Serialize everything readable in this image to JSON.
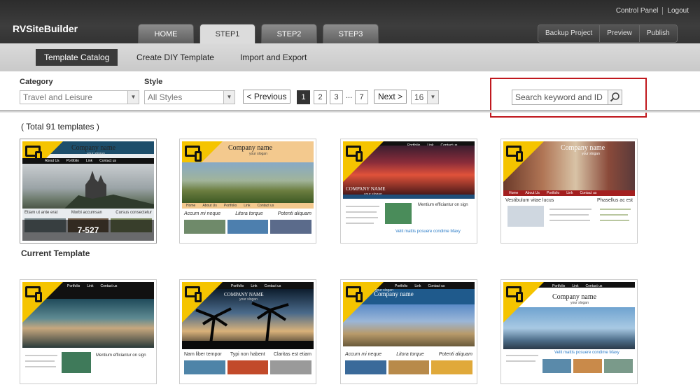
{
  "header": {
    "brand": "RVSiteBuilder",
    "top_links": [
      "Control Panel",
      "Logout"
    ],
    "steps": [
      "HOME",
      "STEP1",
      "STEP2",
      "STEP3"
    ],
    "active_step": "STEP1",
    "actions": [
      "Backup Project",
      "Preview",
      "Publish"
    ]
  },
  "subnav": {
    "tabs": [
      "Template Catalog",
      "Create DIY Template",
      "Import and Export"
    ],
    "active_tab": "Template Catalog"
  },
  "filters": {
    "category_label": "Category",
    "category_value": "Travel and Leisure",
    "style_label": "Style",
    "style_value": "All Styles",
    "previous_label": "< Previous",
    "next_label": "Next >",
    "pages": [
      "1",
      "2",
      "3",
      "7"
    ],
    "current_page": "1",
    "ellipsis": "...",
    "per_page": "16",
    "search_placeholder": "Search keyword and ID"
  },
  "catalog": {
    "total_text": "( Total 91 templates )",
    "current_template_label": "Current Template",
    "current_template_id": "7-527",
    "templates": [
      {
        "company": "Company name",
        "slogan": "your slogan",
        "captions": [
          "Etiam ut ante erat",
          "Morbi accumsan",
          "Cursus consectetur"
        ],
        "nav": [
          "About Us",
          "Portfolio",
          "Link",
          "Contact us"
        ]
      },
      {
        "company": "Company name",
        "slogan": "your slogan",
        "captions": [
          "Accum mi neque",
          "Litora torque",
          "Potenti aliquam"
        ],
        "nav": [
          "Home",
          "About Us",
          "Portfolio",
          "Link",
          "Contact us"
        ]
      },
      {
        "company": "COMPANY NAME",
        "slogan": "your slogan",
        "captions": [
          "Mentium efficiantur on sign",
          "Velit mattis posuere condime Maxy"
        ],
        "nav": [
          "Portfolio",
          "Link",
          "Contact us"
        ]
      },
      {
        "company": "Company name",
        "slogan": "your slogan",
        "captions": [
          "Vestibulum vitae lucus",
          "Phasellus ac est"
        ],
        "nav": [
          "Home",
          "About Us",
          "Portfolio",
          "Link",
          "Contact us"
        ]
      },
      {
        "company": "",
        "slogan": "",
        "captions": [
          "Mentium efficiantur on sign"
        ],
        "nav": [
          "Portfolio",
          "Link",
          "Contact us"
        ]
      },
      {
        "company": "COMPANY NAME",
        "slogan": "your slogan",
        "captions": [
          "Nam liber tempor",
          "Typi non habent",
          "Claritas est etiam"
        ],
        "nav": [
          "Portfolio",
          "Link",
          "Contact us"
        ]
      },
      {
        "company": "Company name",
        "slogan": "your slogan",
        "captions": [
          "Accum mi neque",
          "Litora torque",
          "Potenti aliquam"
        ],
        "nav": [
          "Portfolio",
          "Link",
          "Contact us"
        ]
      },
      {
        "company": "Company name",
        "slogan": "your slogan",
        "captions": [
          "Velit mattis posuere condime Maxy"
        ],
        "nav": [
          "Portfolio",
          "Link",
          "Contact us"
        ]
      }
    ]
  },
  "colors": {
    "accent_yellow": "#f5c400",
    "highlight_red": "#c0181e",
    "header_dark": "#333333"
  }
}
